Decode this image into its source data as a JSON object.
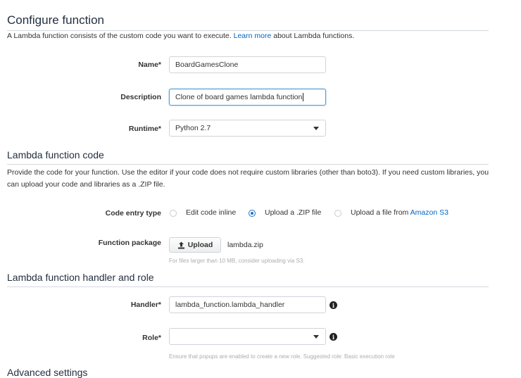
{
  "configure": {
    "title": "Configure function",
    "intro_before": "A Lambda function consists of the custom code you want to execute.",
    "intro_link": "Learn more",
    "intro_after": "about Lambda functions.",
    "name_label": "Name*",
    "name_value": "BoardGamesClone",
    "description_label": "Description",
    "description_value": "Clone of board games lambda function",
    "runtime_label": "Runtime*",
    "runtime_value": "Python 2.7"
  },
  "code": {
    "title": "Lambda function code",
    "intro": "Provide the code for your function. Use the editor if your code does not require custom libraries (other than boto3). If you need custom libraries, you can upload your code and libraries as a .ZIP file.",
    "entry_type_label": "Code entry type",
    "options": [
      {
        "label": "Edit code inline",
        "selected": false
      },
      {
        "label": "Upload a .ZIP file",
        "selected": true
      },
      {
        "label": "Upload a file from",
        "link": "Amazon S3",
        "selected": false
      }
    ],
    "package_label": "Function package",
    "upload_label": "Upload",
    "file_name": "lambda.zip",
    "package_hint": "For files larger than 10 MB, consider uploading via S3."
  },
  "handler_role": {
    "title": "Lambda function handler and role",
    "handler_label": "Handler*",
    "handler_value": "lambda_function.lambda_handler",
    "role_label": "Role*",
    "role_value": "",
    "role_hint": "Ensure that popups are enabled to create a new role. Suggested role: Basic execution role",
    "info_glyph": "i"
  },
  "advanced": {
    "title": "Advanced settings"
  },
  "colors": {
    "link": "#0066c0",
    "accent": "#1a73c8",
    "focus_border": "#4f9fd6"
  }
}
